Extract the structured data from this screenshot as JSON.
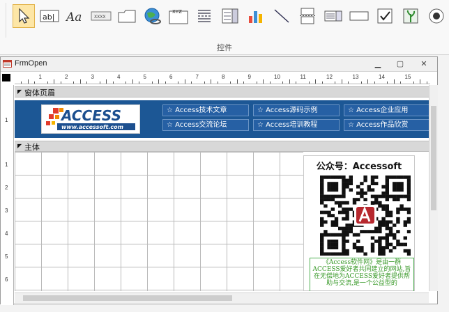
{
  "ribbon": {
    "group_label": "控件",
    "tools": [
      "select-pointer-icon",
      "textbox-icon",
      "label-aa-icon",
      "button-xxxx-icon",
      "tab-control-icon",
      "hyperlink-globe-icon",
      "option-group-xyz-icon",
      "page-break-icon",
      "combo-box-icon",
      "chart-icon",
      "line-icon",
      "insert-page-icon",
      "list-box-icon",
      "rectangle-icon",
      "checkbox-icon",
      "image-icon",
      "option-button-icon"
    ]
  },
  "window": {
    "title": "FrmOpen",
    "minimize": "▁",
    "restore": "▢",
    "close": "✕"
  },
  "sections": {
    "header_label": "窗体页眉",
    "detail_label": "主体"
  },
  "ruler": {
    "h_ticks": [
      "1",
      "2",
      "3",
      "4",
      "5",
      "6",
      "7",
      "8",
      "9",
      "10",
      "11",
      "12",
      "13",
      "14",
      "15"
    ],
    "v_header": [
      "1"
    ],
    "v_detail": [
      "1",
      "2",
      "3",
      "4",
      "5",
      "6"
    ]
  },
  "header": {
    "logo_text": "ACCESS",
    "logo_url": "www.accessoft.com",
    "links": [
      "☆ Access技术文章",
      "☆ Access源码示例",
      "☆ Access企业应用",
      "☆ Access交流论坛",
      "☆ Access培训教程",
      "☆ Access作品欣赏"
    ]
  },
  "panel": {
    "title": "公众号：Accessoft",
    "description": "《Access软件网》是由一群ACCESS爱好者共同建立的网站,旨在无偿地为ACCESS爱好者提供帮助与交流,是一个公益型的"
  },
  "colors": {
    "header_bg": "#1c5795",
    "accent_green": "#3a9a2a"
  }
}
